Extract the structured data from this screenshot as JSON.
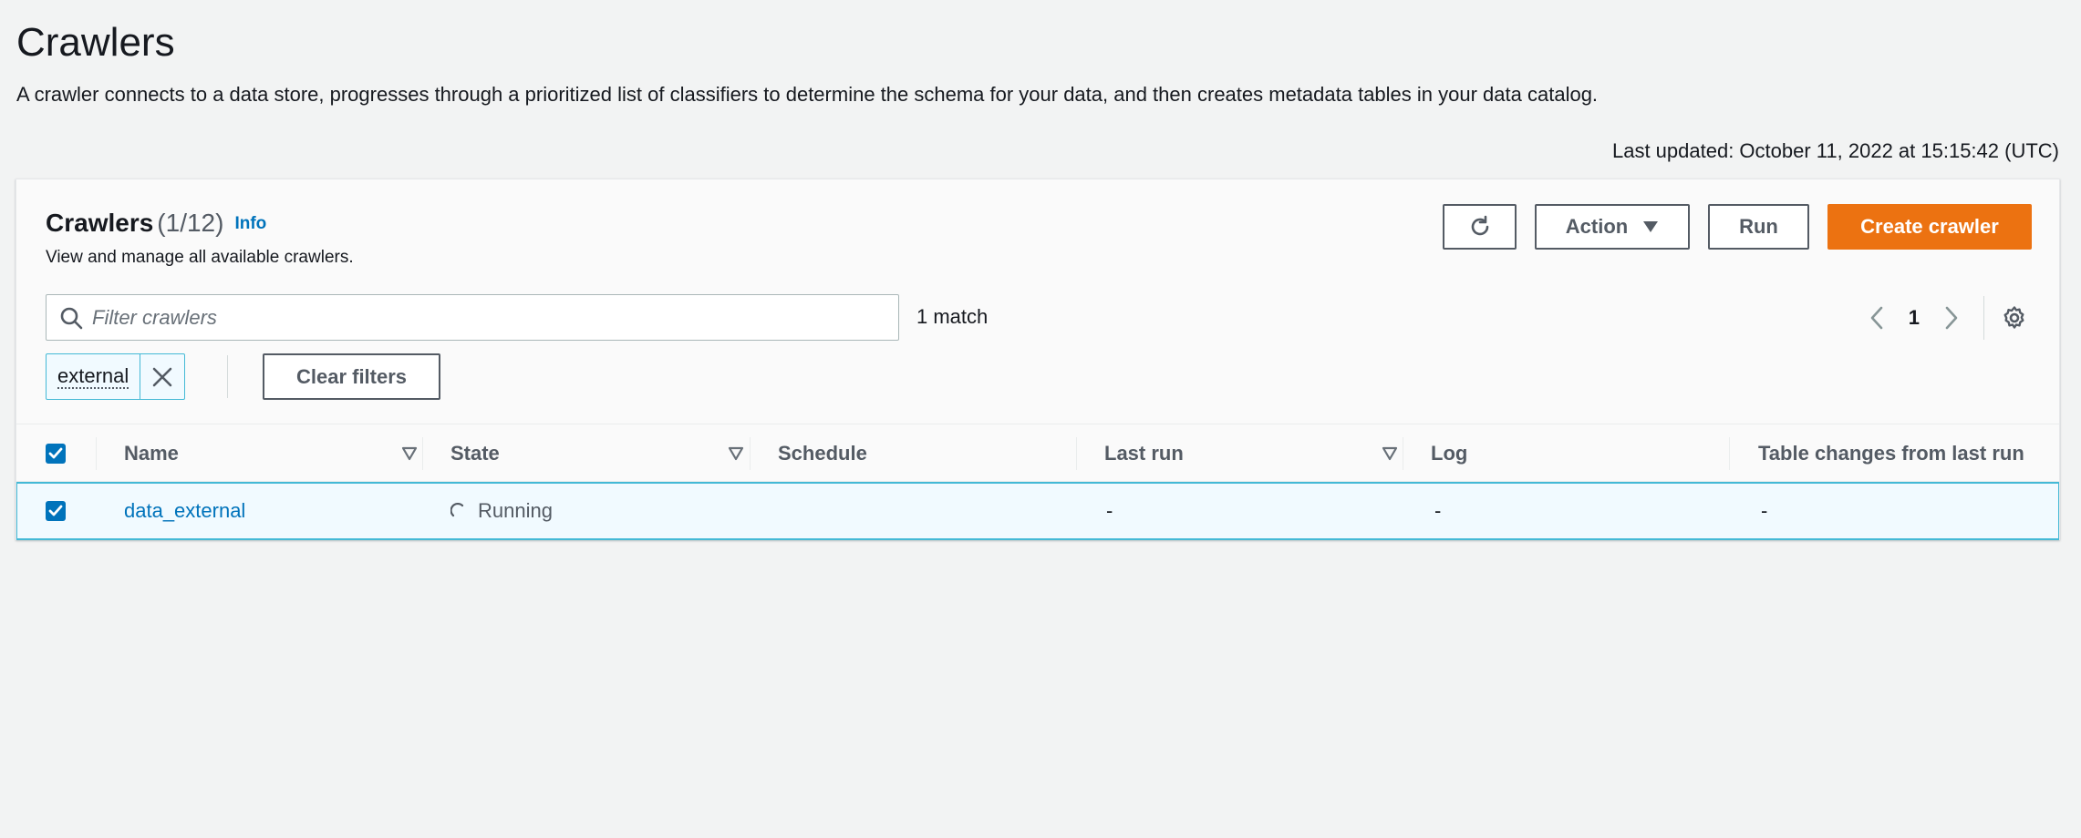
{
  "page": {
    "title": "Crawlers",
    "description": "A crawler connects to a data store, progresses through a prioritized list of classifiers to determine the schema for your data, and then creates metadata tables in your data catalog.",
    "last_updated": "Last updated: October 11, 2022 at 15:15:42 (UTC)"
  },
  "panel": {
    "title": "Crawlers",
    "count": "(1/12)",
    "info_label": "Info",
    "subtitle": "View and manage all available crawlers.",
    "buttons": {
      "refresh_icon": "refresh-icon",
      "action_label": "Action",
      "run_label": "Run",
      "create_label": "Create crawler"
    },
    "filter": {
      "placeholder": "Filter crawlers",
      "value": "",
      "match_text": "1 match",
      "tokens": [
        {
          "label": "external"
        }
      ],
      "clear_label": "Clear filters"
    },
    "pagination": {
      "current_page": "1"
    }
  },
  "table": {
    "columns": [
      {
        "label": "Name",
        "sortable": true
      },
      {
        "label": "State",
        "sortable": true
      },
      {
        "label": "Schedule",
        "sortable": false
      },
      {
        "label": "Last run",
        "sortable": true
      },
      {
        "label": "Log",
        "sortable": false
      },
      {
        "label": "Table changes from last run",
        "sortable": false
      }
    ],
    "rows": [
      {
        "selected": true,
        "name": "data_external",
        "state": "Running",
        "schedule": "",
        "last_run": "-",
        "log": "-",
        "table_changes": "-"
      }
    ]
  },
  "colors": {
    "primary": "#ec7211",
    "link": "#0073bb",
    "selection_border": "#44b9d6",
    "selection_bg": "#f1faff",
    "background": "#f2f3f3"
  }
}
